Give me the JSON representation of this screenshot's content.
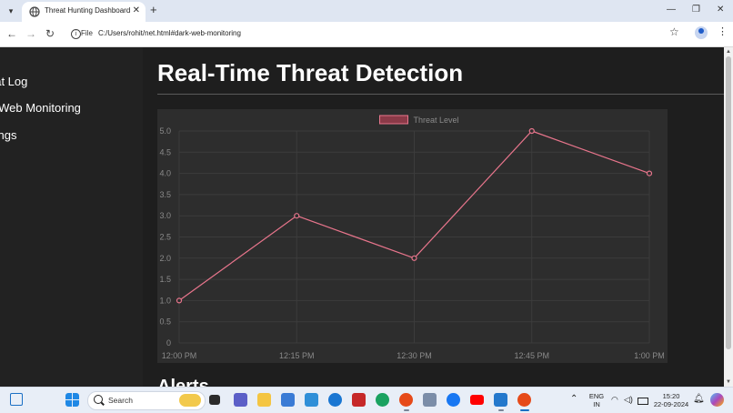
{
  "browser": {
    "tab_title": "Threat Hunting Dashboard",
    "tab_close": "✕",
    "new_tab": "+",
    "address_scheme": "File",
    "address_url": "C:/Users/rohit/net.html#dark-web-monitoring",
    "window_controls": {
      "minimize": "—",
      "restore": "❐",
      "close": "✕"
    },
    "icons": [
      "tab-search-icon",
      "globe-icon",
      "back-arrow-icon",
      "forward-arrow-icon",
      "reload-icon",
      "info-icon",
      "star-icon",
      "profile-icon",
      "kebab-menu-icon"
    ]
  },
  "sidebar": {
    "items": [
      {
        "label": "eat Log"
      },
      {
        "label": "k Web Monitoring"
      },
      {
        "label": "tings"
      }
    ]
  },
  "main": {
    "title": "Real-Time Threat Detection",
    "alerts_heading": "Alerts"
  },
  "chart_data": {
    "type": "line",
    "x": [
      "12:00 PM",
      "12:15 PM",
      "12:30 PM",
      "12:45 PM",
      "1:00 PM"
    ],
    "series": [
      {
        "name": "Threat Level",
        "values": [
          1,
          3,
          2,
          5,
          4
        ]
      }
    ],
    "ylim": [
      0,
      5
    ],
    "yticks": [
      0,
      0.5,
      1.0,
      1.5,
      2.0,
      2.5,
      3.0,
      3.5,
      4.0,
      4.5,
      5.0
    ],
    "grid": true,
    "legend": "top-center",
    "colors": {
      "line": "#e8758c",
      "legend_fill": "#8b3a48",
      "grid": "#3c3c3c",
      "ticks": "#8a8a8a",
      "background": "#2d2d2d"
    }
  },
  "taskbar": {
    "search_placeholder": "Search",
    "lang_top": "ENG",
    "lang_bottom": "IN",
    "time": "15:20",
    "date": "22-09-2024",
    "icons": [
      "widgets-icon",
      "windows-start-icon",
      "task-view-icon",
      "teams-icon",
      "file-explorer-icon",
      "store-icon",
      "app-icon",
      "edge-dev-icon",
      "mcafee-icon",
      "edge-icon",
      "chrome-icon",
      "app-icon-2",
      "facebook-icon",
      "youtube-icon",
      "vscode-icon",
      "chrome-active-icon",
      "tray-chevron-icon",
      "wifi-icon",
      "volume-icon",
      "battery-icon",
      "notification-bell-icon",
      "copilot-icon"
    ]
  }
}
